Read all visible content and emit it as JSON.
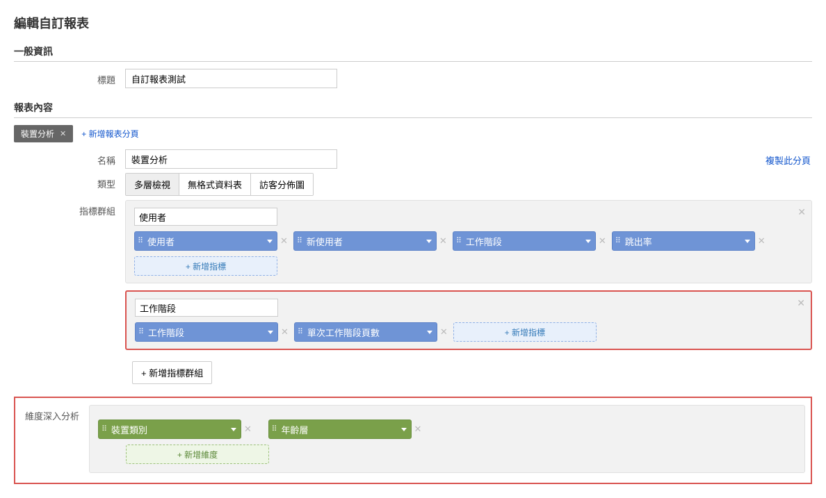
{
  "page_title": "編輯自訂報表",
  "general": {
    "heading": "一般資訊",
    "title_label": "標題",
    "title_value": "自訂報表測試"
  },
  "content": {
    "heading": "報表內容",
    "tab_label": "裝置分析",
    "add_tab": "+ 新增報表分頁",
    "name_label": "名稱",
    "name_value": "裝置分析",
    "duplicate": "複製此分頁",
    "type_label": "類型",
    "types": {
      "t0": "多層檢視",
      "t1": "無格式資料表",
      "t2": "訪客分佈圖"
    }
  },
  "metrics": {
    "label": "指標群組",
    "group1_name": "使用者",
    "g1m0": "使用者",
    "g1m1": "新使用者",
    "g1m2": "工作階段",
    "g1m3": "跳出率",
    "group2_name": "工作階段",
    "g2m0": "工作階段",
    "g2m1": "單次工作階段頁數",
    "add_metric": "+ 新增指標",
    "add_group": "+ 新增指標群組"
  },
  "dims": {
    "label": "維度深入分析",
    "d0": "裝置類別",
    "d1": "年齡層",
    "add_dim": "+ 新增維度"
  }
}
